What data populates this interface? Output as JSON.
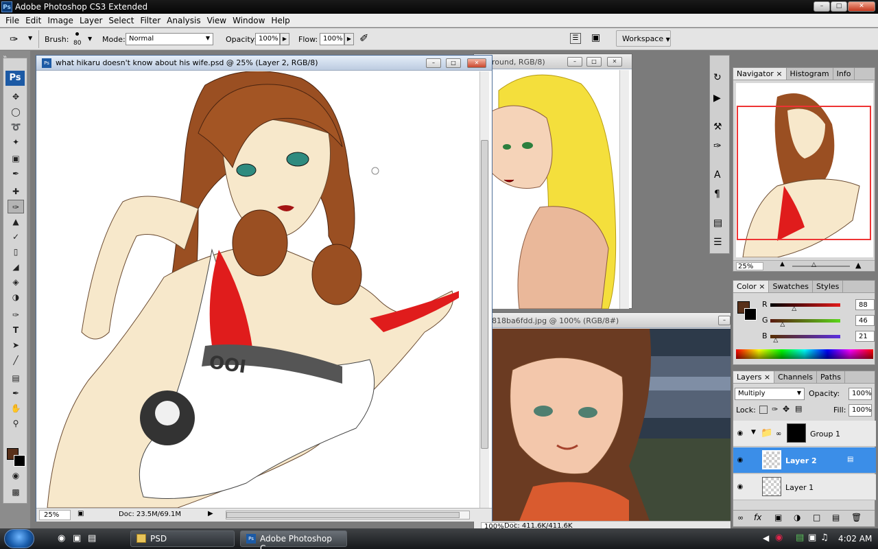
{
  "app": {
    "title": "Adobe Photoshop CS3 Extended",
    "logo": "Ps"
  },
  "menu": [
    "File",
    "Edit",
    "Image",
    "Layer",
    "Select",
    "Filter",
    "Analysis",
    "View",
    "Window",
    "Help"
  ],
  "options": {
    "brush_label": "Brush:",
    "brush_size": "80",
    "mode_label": "Mode:",
    "mode_value": "Normal",
    "opacity_label": "Opacity:",
    "opacity_value": "100%",
    "flow_label": "Flow:",
    "flow_value": "100%",
    "workspace_label": "Workspace"
  },
  "documents": [
    {
      "title": "what hikaru doesn't know about his wife.psd @ 25% (Layer 2, RGB/8)",
      "zoom": "25%",
      "doc_size": "Doc: 23.5M/69.1M"
    },
    {
      "title": "round, RGB/8)"
    },
    {
      "title": "818ba6fdd.jpg @ 100% (RGB/8#)",
      "zoom": "100%",
      "doc_size": "Doc: 411.6K/411.6K"
    }
  ],
  "navigator": {
    "tabs": [
      "Navigator",
      "Histogram",
      "Info"
    ],
    "zoom": "25%"
  },
  "color_panel": {
    "tabs": [
      "Color",
      "Swatches",
      "Styles"
    ],
    "channels": [
      {
        "label": "R",
        "value": "88",
        "fraction": 0.345
      },
      {
        "label": "G",
        "value": "46",
        "fraction": 0.18
      },
      {
        "label": "B",
        "value": "21",
        "fraction": 0.082
      }
    ],
    "foreground": "#58301a"
  },
  "layers_panel": {
    "tabs": [
      "Layers",
      "Channels",
      "Paths"
    ],
    "blend_mode": "Multiply",
    "opacity_label": "Opacity:",
    "opacity_value": "100%",
    "lock_label": "Lock:",
    "fill_label": "Fill:",
    "fill_value": "100%",
    "layers": [
      {
        "name": "Group 1"
      },
      {
        "name": "Layer 2"
      },
      {
        "name": "Layer 1"
      }
    ]
  },
  "taskbar": {
    "buttons": [
      {
        "label": "PSD"
      },
      {
        "label": "Adobe Photoshop C..."
      }
    ],
    "time": "4:02 AM"
  }
}
